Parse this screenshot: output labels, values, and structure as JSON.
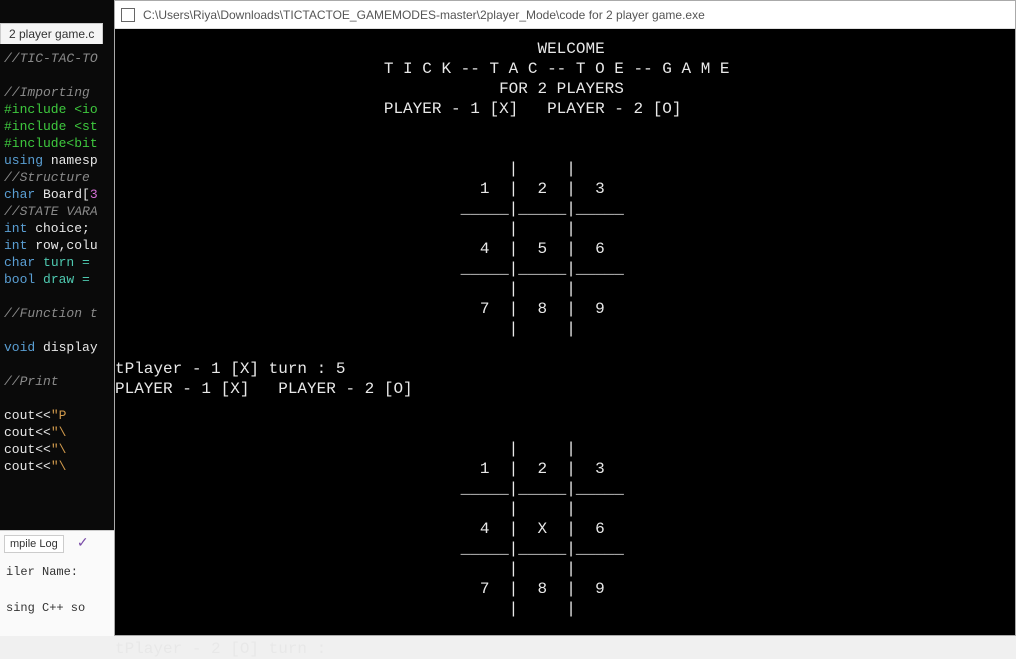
{
  "editor": {
    "tab_label": "2 player game.c",
    "code_lines": [
      {
        "cls": "italic-cmt",
        "text": "//TIC-TAC-TO"
      },
      {
        "cls": "",
        "text": ""
      },
      {
        "cls": "italic-cmt",
        "text": "//Importing"
      },
      {
        "cls": "green",
        "text": "#include <io"
      },
      {
        "cls": "green",
        "text": "#include <st"
      },
      {
        "cls": "green",
        "text": "#include<bit"
      },
      {
        "cls": "blue",
        "text": "using",
        "rest": " namesp",
        "rest_cls": "white"
      },
      {
        "cls": "italic-cmt",
        "text": "//Structure"
      },
      {
        "cls": "blue",
        "text": "char",
        "rest": " Board[",
        "rest_cls": "white",
        "tail": "3",
        "tail_cls": "pink"
      },
      {
        "cls": "italic-cmt",
        "text": "//STATE VARA"
      },
      {
        "cls": "blue",
        "text": "int",
        "rest": " choice;",
        "rest_cls": "white"
      },
      {
        "cls": "blue",
        "text": "int",
        "rest": " row,colu",
        "rest_cls": "white"
      },
      {
        "cls": "blue",
        "text": "char",
        "rest": " turn =",
        "rest_cls": "cyan"
      },
      {
        "cls": "blue",
        "text": "bool",
        "rest": " draw =",
        "rest_cls": "cyan"
      },
      {
        "cls": "",
        "text": ""
      },
      {
        "cls": "italic-cmt",
        "text": "//Function t"
      },
      {
        "cls": "",
        "text": ""
      },
      {
        "cls": "blue",
        "text": "void",
        "rest": " display",
        "rest_cls": "white"
      },
      {
        "cls": "",
        "text": ""
      },
      {
        "cls": "italic-cmt",
        "text": "   //Print"
      },
      {
        "cls": "",
        "text": ""
      },
      {
        "cls": "white",
        "text": "   cout<<",
        "rest": "\"P",
        "rest_cls": "orange"
      },
      {
        "cls": "white",
        "text": "   cout<<",
        "rest": "\"\\",
        "rest_cls": "orange"
      },
      {
        "cls": "white",
        "text": "   cout<<",
        "rest": "\"\\",
        "rest_cls": "orange"
      },
      {
        "cls": "white",
        "text": "   cout<<",
        "rest": "\"\\",
        "rest_cls": "orange"
      }
    ]
  },
  "compile": {
    "tab_label": "mpile Log",
    "line1": "iler Name:",
    "line2": "sing C++ so"
  },
  "console": {
    "title": " C:\\Users\\Riya\\Downloads\\TICTACTOE_GAMEMODES-master\\2player_Mode\\code for 2 player game.exe",
    "header": {
      "welcome": "WELCOME",
      "title_spaced": "T I C K -- T A C -- T O E -- G A M E",
      "subtitle": "FOR 2 PLAYERS",
      "players": "PLAYER - 1 [X]   PLAYER - 2 [O]"
    },
    "board1": {
      "cells": [
        "1",
        "2",
        "3",
        "4",
        "5",
        "6",
        "7",
        "8",
        "9"
      ]
    },
    "turn1": "tPlayer - 1 [X] turn : 5",
    "players_line2": "PLAYER - 1 [X]   PLAYER - 2 [O]",
    "board2": {
      "cells": [
        "1",
        "2",
        "3",
        "4",
        "X",
        "6",
        "7",
        "8",
        "9"
      ]
    },
    "turn2": "tPlayer - 2 [O] turn :"
  }
}
